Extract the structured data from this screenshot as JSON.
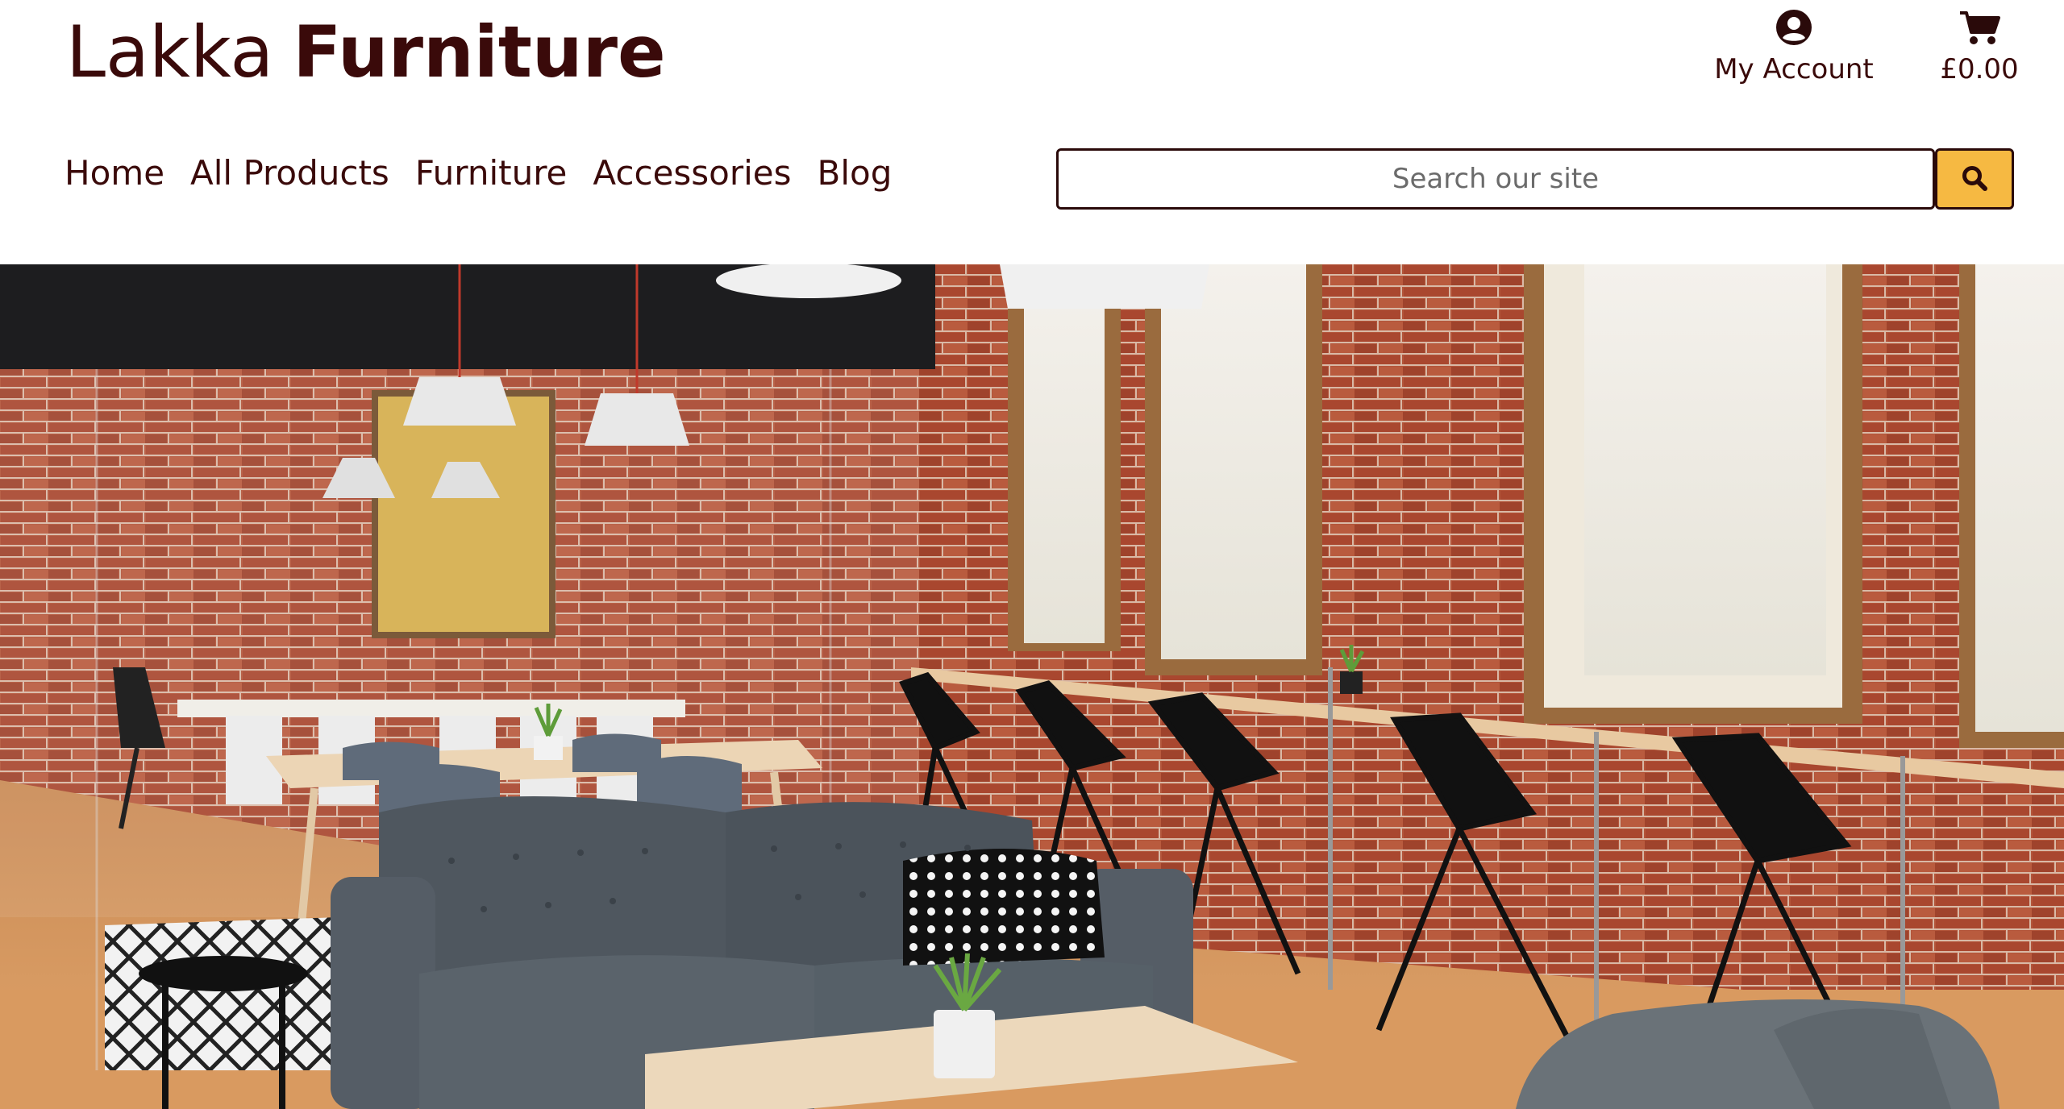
{
  "brand": {
    "name_light": "Lakka",
    "name_bold": "Furniture"
  },
  "account": {
    "label": "My Account",
    "icon": "user-circle-icon"
  },
  "cart": {
    "total": "£0.00",
    "icon": "shopping-cart-icon"
  },
  "nav": {
    "items": [
      {
        "label": "Home"
      },
      {
        "label": "All Products"
      },
      {
        "label": "Furniture"
      },
      {
        "label": "Accessories"
      },
      {
        "label": "Blog"
      }
    ]
  },
  "search": {
    "placeholder": "Search our site",
    "value": "",
    "button_icon": "search-icon"
  },
  "colors": {
    "brand_text": "#3a0a0a",
    "search_button": "#f6b942"
  }
}
